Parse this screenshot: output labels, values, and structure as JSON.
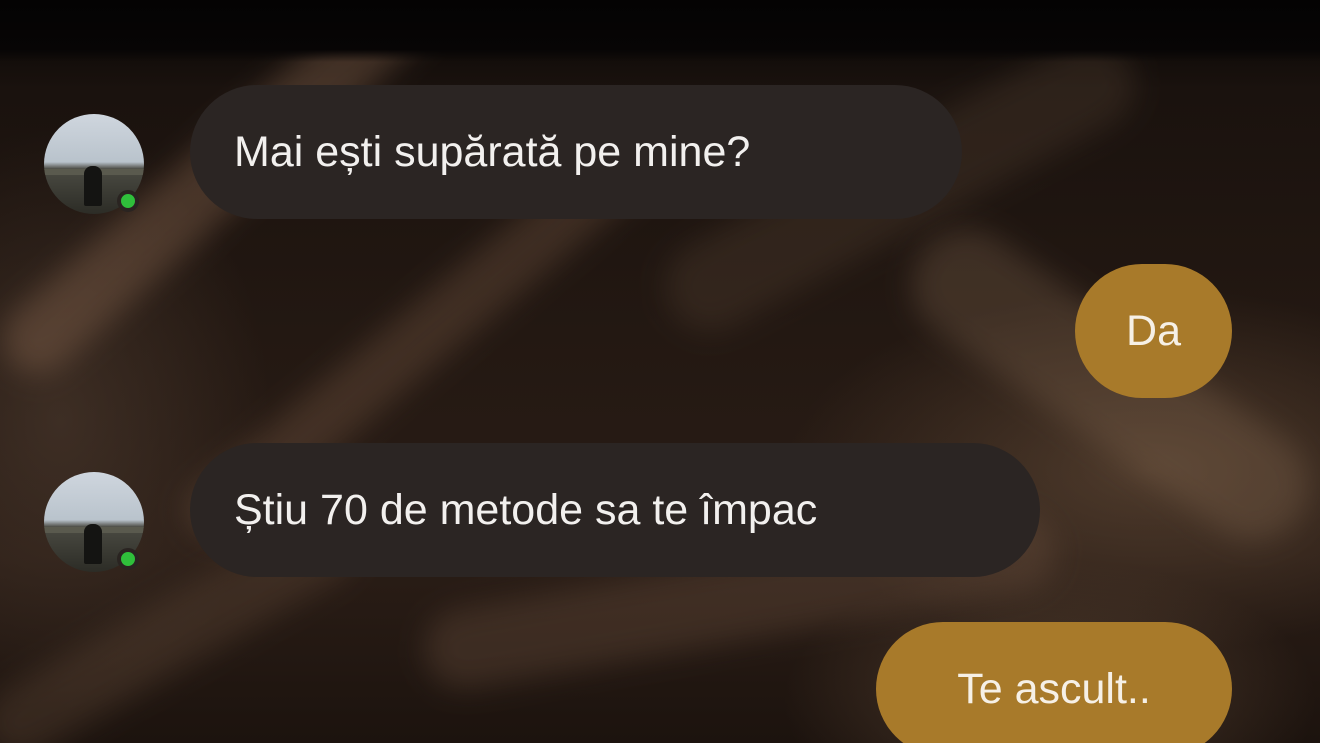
{
  "messages": [
    {
      "direction": "incoming",
      "text": "Mai ești supărată pe mine?",
      "avatar": "contact-photo",
      "status": "online"
    },
    {
      "direction": "outgoing",
      "text": "Da"
    },
    {
      "direction": "incoming",
      "text": "Știu 70 de metode sa te împac",
      "avatar": "contact-photo",
      "status": "online"
    },
    {
      "direction": "outgoing",
      "text": "Te ascult.."
    }
  ],
  "colors": {
    "incoming_bubble": "#2b2523",
    "outgoing_bubble": "#a87a2a",
    "online_dot": "#2fbf3b",
    "text": "#f2f0ee"
  },
  "icons": [
    "contact-avatar",
    "online-status-dot"
  ]
}
